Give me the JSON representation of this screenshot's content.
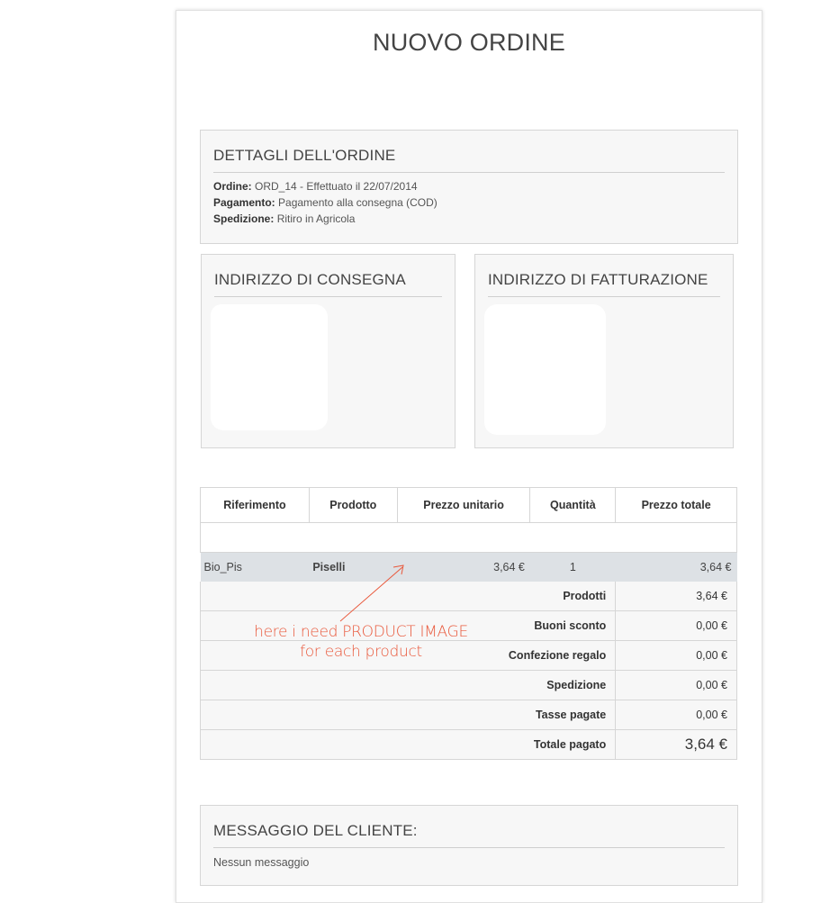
{
  "title": "NUOVO ORDINE",
  "details": {
    "heading": "DETTAGLI DELL'ORDINE",
    "order_label": "Ordine:",
    "order_value": "ORD_14 - Effettuato il 22/07/2014",
    "payment_label": "Pagamento:",
    "payment_value": "Pagamento alla consegna (COD)",
    "shipping_label": "Spedizione:",
    "shipping_value": "Ritiro in Agricola"
  },
  "delivery_address": {
    "heading": "INDIRIZZO DI CONSEGNA"
  },
  "billing_address": {
    "heading": "INDIRIZZO DI FATTURAZIONE"
  },
  "table": {
    "headers": [
      "Riferimento",
      "Prodotto",
      "Prezzo unitario",
      "Quantità",
      "Prezzo totale"
    ],
    "product": {
      "reference": "Bio_Pis",
      "name": "Piselli",
      "unit_price": "3,64 €",
      "quantity": "1",
      "total": "3,64 €"
    },
    "summary": [
      {
        "label": "Prodotti",
        "value": "3,64 €"
      },
      {
        "label": "Buoni sconto",
        "value": "0,00 €"
      },
      {
        "label": "Confezione regalo",
        "value": "0,00 €"
      },
      {
        "label": "Spedizione",
        "value": "0,00 €"
      },
      {
        "label": "Tasse pagate",
        "value": "0,00 €"
      },
      {
        "label": "Totale pagato",
        "value": "3,64 €"
      }
    ]
  },
  "annotation": {
    "line1": "here i need PRODUCT IMAGE",
    "line2": "for each product",
    "color": "#e9583b"
  },
  "message": {
    "heading": "MESSAGGIO DEL CLIENTE:",
    "text": "Nessun messaggio"
  }
}
